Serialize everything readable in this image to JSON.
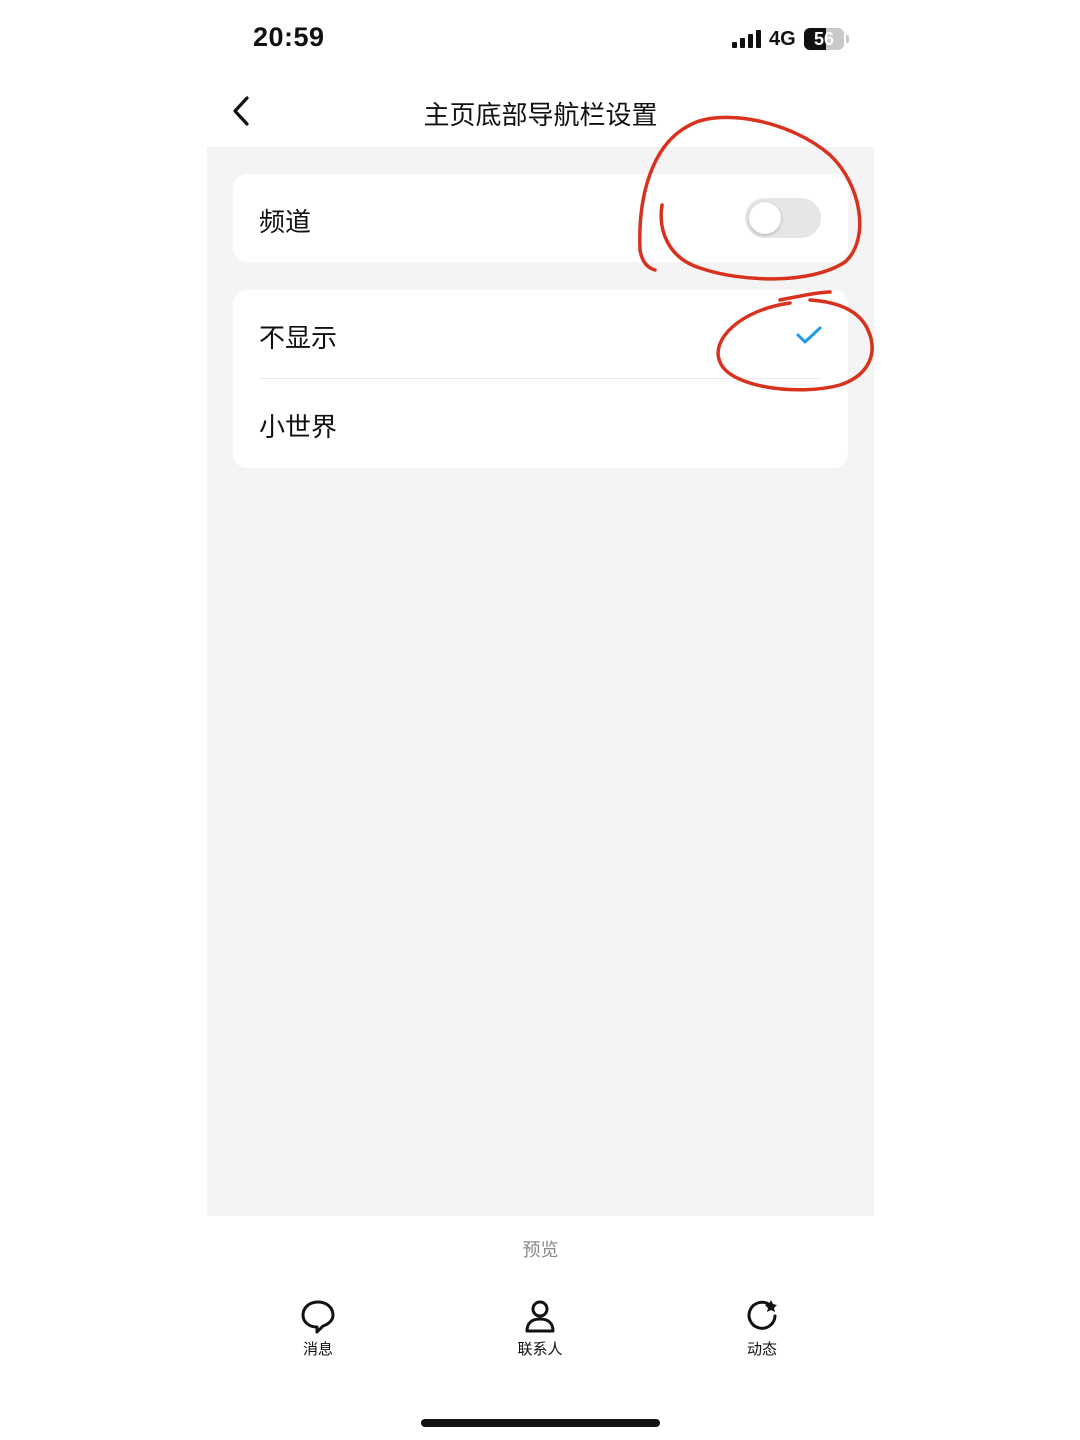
{
  "status_bar": {
    "time": "20:59",
    "network": "4G",
    "battery_level": "56",
    "battery_fraction": 0.56
  },
  "nav": {
    "title": "主页底部导航栏设置",
    "back_icon": "chevron-left-icon"
  },
  "settings": {
    "channel_label": "频道",
    "channel_enabled": false,
    "options": [
      {
        "label": "不显示",
        "selected": true
      },
      {
        "label": "小世界",
        "selected": false
      }
    ]
  },
  "preview": {
    "label": "预览",
    "tabs": [
      {
        "label": "消息",
        "icon": "chat-bubble-icon"
      },
      {
        "label": "联系人",
        "icon": "person-icon"
      },
      {
        "label": "动态",
        "icon": "refresh-star-icon"
      }
    ]
  },
  "colors": {
    "accent": "#1e9bf0",
    "annotation": "#d8321f",
    "background": "#f4f4f4"
  }
}
